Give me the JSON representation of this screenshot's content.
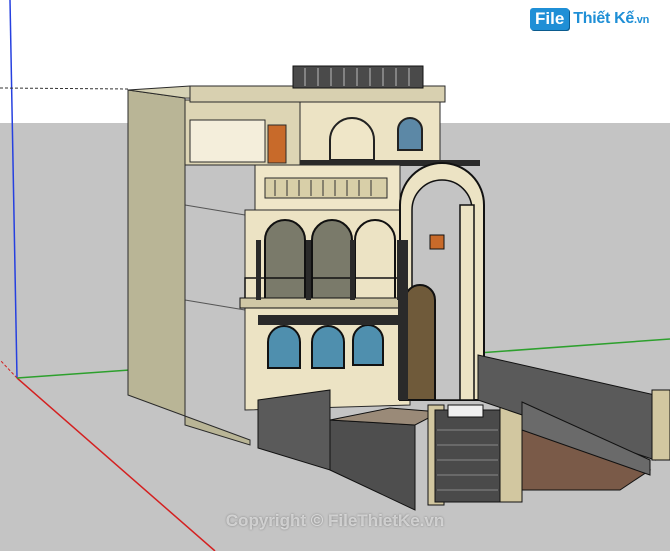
{
  "logo": {
    "file": "File",
    "rest": "Thiết Kế",
    "tld": ".vn"
  },
  "watermark": "Copyright © FileThietKe.vn",
  "colors": {
    "sky": "#ffffff",
    "ground": "#c4c4c4",
    "wall_cream": "#ece3c4",
    "wall_shadow": "#a9a48a",
    "wall_side": "#b9b596",
    "fence": "#5a5a5a",
    "glass": "#8fb7d0",
    "axis_red": "#d42020",
    "axis_green": "#2da02d",
    "axis_blue": "#2640e0"
  }
}
